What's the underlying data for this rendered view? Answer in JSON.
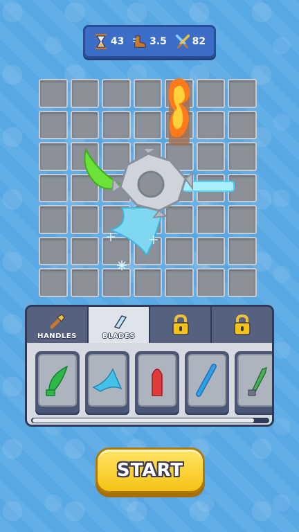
{
  "stats": {
    "time": "43",
    "speed": "3.5",
    "damage": "82",
    "icons": [
      "hourglass-icon",
      "boot-icon",
      "crossed-swords-icon"
    ]
  },
  "board": {
    "rows": 7,
    "cols": 7
  },
  "tabs": [
    {
      "label": "HANDLES",
      "icon": "handle-icon",
      "active": false,
      "locked": false
    },
    {
      "label": "BLADES",
      "icon": "blade-icon",
      "active": true,
      "locked": false
    },
    {
      "label": "",
      "icon": "lock-icon",
      "active": false,
      "locked": true
    },
    {
      "label": "",
      "icon": "lock-icon",
      "active": false,
      "locked": true
    }
  ],
  "items": [
    {
      "name": "green-leaf-blade",
      "color": "#2eb84a"
    },
    {
      "name": "ice-wing-blade",
      "color": "#43c1e8"
    },
    {
      "name": "red-bullet-blade",
      "color": "#e23a3a"
    },
    {
      "name": "blue-stick-blade",
      "color": "#2e9ee8"
    },
    {
      "name": "green-dagger-blade",
      "color": "#4cae5a"
    }
  ],
  "start_button": {
    "label": "START"
  },
  "colors": {
    "accent": "#f5c214",
    "panel": "#2d3a5a",
    "background": "#5aa9e4"
  }
}
